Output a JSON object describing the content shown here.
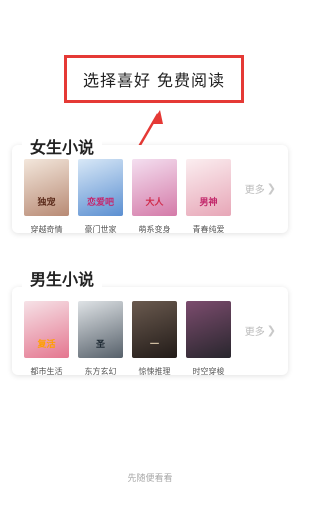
{
  "callout": {
    "text": "选择喜好 免费阅读"
  },
  "sections": [
    {
      "title": "女生小说",
      "more": "更多",
      "books": [
        {
          "label": "穿越奇情",
          "cover_text": "独宠",
          "cover_colors": [
            "#f3e7dc",
            "#b88a74"
          ],
          "text_color": "#5a2a1a"
        },
        {
          "label": "豪门世家",
          "cover_text": "恋爱吧",
          "cover_colors": [
            "#d8e8f7",
            "#5b8fd1"
          ],
          "text_color": "#c4286e"
        },
        {
          "label": "萌系变身",
          "cover_text": "大人",
          "cover_colors": [
            "#f4dff0",
            "#d47aa8"
          ],
          "text_color": "#d02c4c"
        },
        {
          "label": "青春纯爱",
          "cover_text": "男神",
          "cover_colors": [
            "#fbeef0",
            "#e7a6b7"
          ],
          "text_color": "#c2286a"
        }
      ]
    },
    {
      "title": "男生小说",
      "more": "更多",
      "books": [
        {
          "label": "都市生活",
          "cover_text": "复活",
          "cover_colors": [
            "#f6e2e7",
            "#e4768f"
          ],
          "text_color": "#ffa000"
        },
        {
          "label": "东方玄幻",
          "cover_text": "圣",
          "cover_colors": [
            "#dfe3e6",
            "#56606a"
          ],
          "text_color": "#1e2a34"
        },
        {
          "label": "惊悚推理",
          "cover_text": "一",
          "cover_colors": [
            "#6a5a4f",
            "#221b18"
          ],
          "text_color": "#d8c6a8"
        },
        {
          "label": "时空穿梭",
          "cover_text": "",
          "cover_colors": [
            "#7c4c6e",
            "#28262d"
          ],
          "text_color": "#f0d0e0"
        }
      ]
    }
  ],
  "footer": {
    "text": "先随便看看"
  },
  "colors": {
    "accent_red": "#e53935",
    "more_gray": "#bbbbbb"
  }
}
